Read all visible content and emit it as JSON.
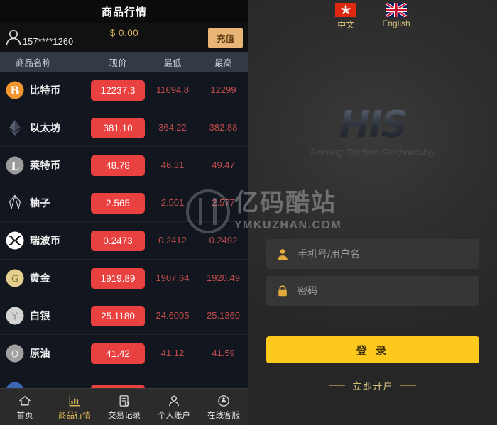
{
  "left": {
    "title": "商品行情",
    "account": {
      "phone": "157****1260",
      "balance": "$ 0.00",
      "recharge_label": "充值",
      "avatar_icon": "user-avatar-icon"
    },
    "table": {
      "columns": [
        "商品名称",
        "现价",
        "最低",
        "最高"
      ],
      "rows": [
        {
          "icon": "bitcoin-icon",
          "name": "比特币",
          "price": "12237.3",
          "low": "11694.8",
          "high": "12299"
        },
        {
          "icon": "ethereum-icon",
          "name": "以太坊",
          "price": "381.10",
          "low": "364.22",
          "high": "382.88"
        },
        {
          "icon": "litecoin-icon",
          "name": "莱特币",
          "price": "48.78",
          "low": "46.31",
          "high": "49.47"
        },
        {
          "icon": "eos-icon",
          "name": "柚子",
          "price": "2.565",
          "low": "2.501",
          "high": "2.577"
        },
        {
          "icon": "ripple-icon",
          "name": "瑞波币",
          "price": "0.2473",
          "low": "0.2412",
          "high": "0.2492"
        },
        {
          "icon": "gold-icon",
          "name": "黄金",
          "price": "1919.89",
          "low": "1907.64",
          "high": "1920.49"
        },
        {
          "icon": "silver-icon",
          "name": "白银",
          "price": "25.1180",
          "low": "24.6005",
          "high": "25.1360"
        },
        {
          "icon": "oil-icon",
          "name": "原油",
          "price": "41.42",
          "low": "41.12",
          "high": "41.59"
        },
        {
          "icon": "index-icon",
          "name": "",
          "price": "",
          "low": "",
          "high": ""
        }
      ]
    },
    "nav": [
      {
        "label": "首页",
        "icon": "home-icon",
        "active": false
      },
      {
        "label": "商品行情",
        "icon": "chart-icon",
        "active": true
      },
      {
        "label": "交易记录",
        "icon": "document-icon",
        "active": false
      },
      {
        "label": "个人账户",
        "icon": "person-icon",
        "active": false
      },
      {
        "label": "在线客服",
        "icon": "headset-icon",
        "active": false
      }
    ]
  },
  "right": {
    "languages": [
      {
        "label": "中文",
        "flag": "hongkong-flag-icon"
      },
      {
        "label": "English",
        "flag": "unionjack-flag-icon"
      }
    ],
    "logo": {
      "mark": "HIS",
      "tagline": "Serving Traders Responsibly"
    },
    "form": {
      "username_placeholder": "手机号/用户名",
      "username_value": "",
      "username_icon": "person-icon",
      "password_placeholder": "密码",
      "password_value": "",
      "password_icon": "lock-icon"
    },
    "login_label": "登 录",
    "register_label": "立即开户"
  },
  "watermark": {
    "main": "亿码酷站",
    "sub": "YMKUZHAN.COM"
  },
  "colors": {
    "accent_yellow": "#fcc91c",
    "price_red": "#e8413f",
    "gold_text": "#d9c27e",
    "panel_dark": "#12161f",
    "header_gray": "#333945"
  }
}
